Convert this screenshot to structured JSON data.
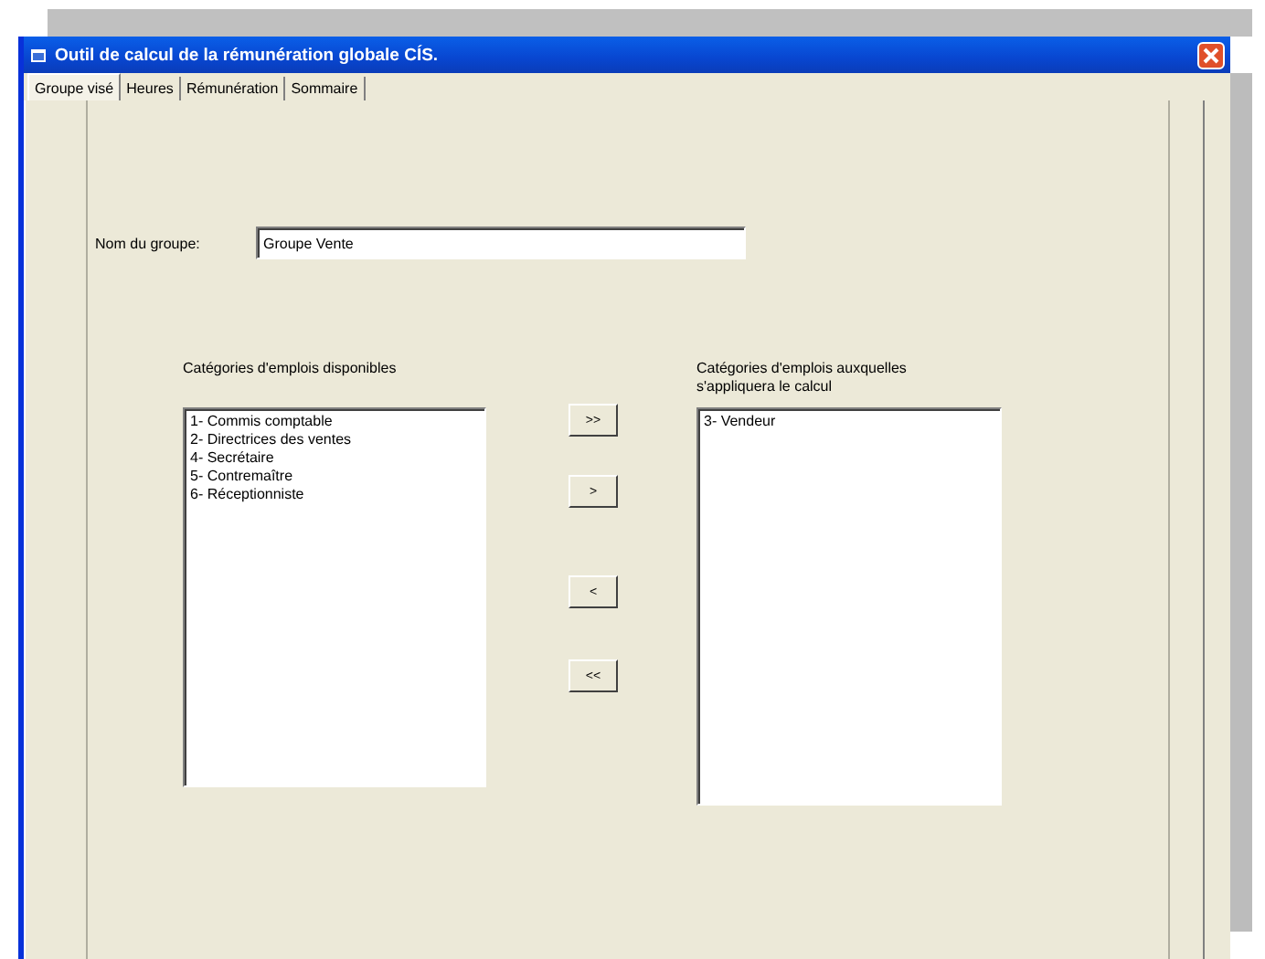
{
  "window": {
    "title": "Outil de calcul de la rémunération globale CÍS."
  },
  "tabs": [
    {
      "label": "Groupe visé",
      "selected": true
    },
    {
      "label": "Heures",
      "selected": false
    },
    {
      "label": "Rémunération",
      "selected": false
    },
    {
      "label": "Sommaire",
      "selected": false
    }
  ],
  "group_name": {
    "label": "Nom du groupe:",
    "value": "Groupe Vente"
  },
  "available": {
    "label": "Catégories d'emplois disponibles",
    "items": [
      "1- Commis comptable",
      "2- Directrices des ventes",
      "4- Secrétaire",
      "5- Contremaître",
      "6- Réceptionniste"
    ]
  },
  "buttons": [
    ">>",
    ">",
    "<",
    "<<"
  ],
  "chosen": {
    "label": "Catégories d'emplois auxquelles s'appliquera le calcul",
    "items": [
      "3- Vendeur"
    ]
  }
}
